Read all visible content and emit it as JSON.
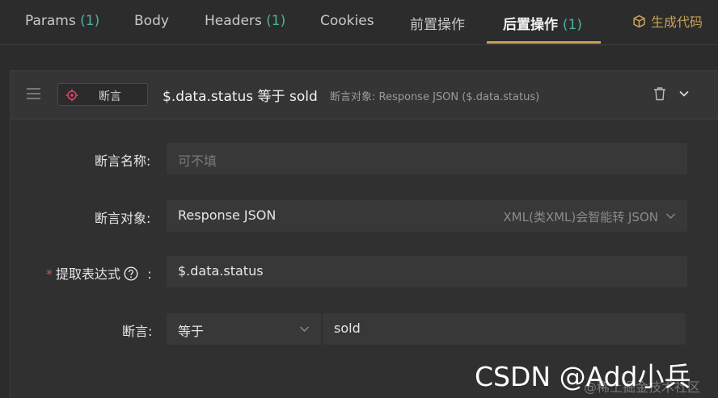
{
  "tabs": [
    {
      "label": "Params",
      "count": "(1)"
    },
    {
      "label": "Body",
      "count": ""
    },
    {
      "label": "Headers",
      "count": "(1)"
    },
    {
      "label": "Cookies",
      "count": ""
    },
    {
      "label": "前置操作",
      "count": ""
    },
    {
      "label": "后置操作",
      "count": "(1)"
    }
  ],
  "active_tab": "后置操作",
  "generate_code_label": "生成代码",
  "assertion": {
    "type_label": "断言",
    "title": "$.data.status 等于 sold",
    "subtitle": "断言对象: Response JSON ($.data.status)"
  },
  "form": {
    "name_label": "断言名称:",
    "name_placeholder": "可不填",
    "target_label": "断言对象:",
    "target_value": "Response JSON",
    "target_hint": "XML(类XML)会智能转 JSON",
    "expr_required": "*",
    "expr_label": "提取表达式",
    "expr_colon": ":",
    "expr_value": "$.data.status",
    "assert_label": "断言:",
    "operator_value": "等于",
    "expected_value": "sold"
  },
  "watermark": {
    "main": "CSDN @Add小兵",
    "sub": "@稀土掘金技术社区"
  },
  "colors": {
    "accent": "#c7a256",
    "count_green": "#4db39a",
    "required_red": "#d9534f",
    "target_icon_red": "#e0446a"
  }
}
